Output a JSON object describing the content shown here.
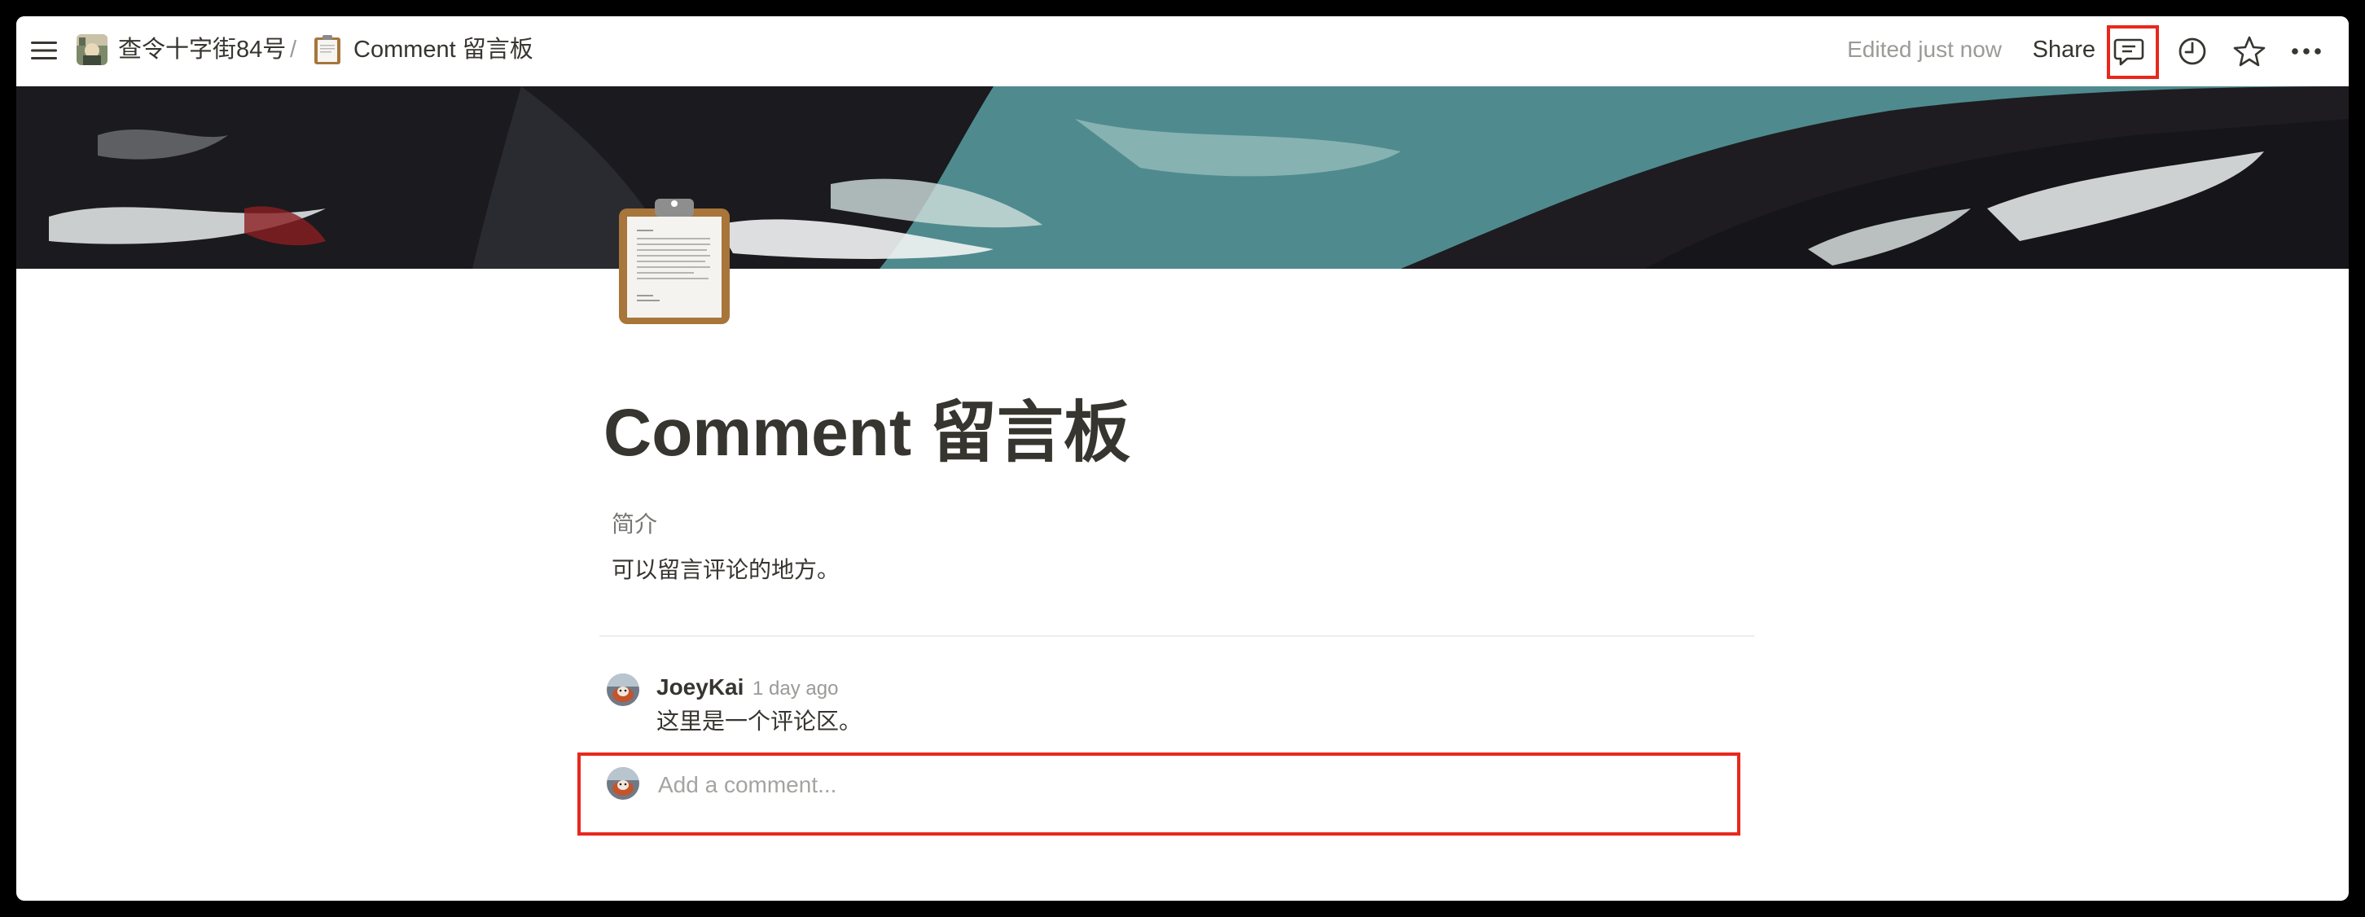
{
  "topbar": {
    "workspace_name": "查令十字街84号",
    "separator": "/",
    "page_name": "Comment 留言板",
    "edited_status": "Edited just now",
    "share_label": "Share",
    "icons": [
      "menu-icon",
      "comment-icon",
      "clock-icon",
      "star-icon",
      "more-icon"
    ]
  },
  "page": {
    "icon": "clipboard-icon",
    "title": "Comment 留言板",
    "property_label": "简介",
    "property_value": "可以留言评论的地方。"
  },
  "comments": [
    {
      "author": "JoeyKai",
      "time": "1 day ago",
      "text": "这里是一个评论区。"
    }
  ],
  "comment_input": {
    "placeholder": "Add a comment..."
  },
  "colors": {
    "highlight": "#e8281c",
    "text": "#37352f",
    "muted": "#9b9a97"
  }
}
